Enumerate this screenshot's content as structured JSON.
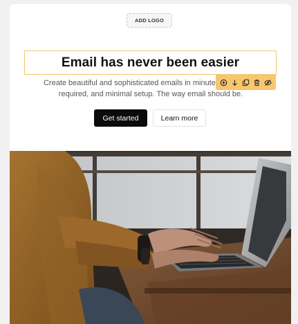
{
  "header": {
    "add_logo_label": "ADD LOGO"
  },
  "content": {
    "title": "Email has never been easier",
    "subtitle": "Create beautiful and sophisticated emails in minutes. No coding required, and minimal setup. The way email should be.",
    "primary_button": "Get started",
    "secondary_button": "Learn more"
  },
  "toolbar": {
    "icons": [
      "add-icon",
      "move-down-icon",
      "duplicate-icon",
      "delete-icon",
      "hide-icon"
    ]
  },
  "colors": {
    "accent": "#f7c66d",
    "selection_border": "#f2c66a",
    "primary_button_bg": "#0b0b0b"
  }
}
